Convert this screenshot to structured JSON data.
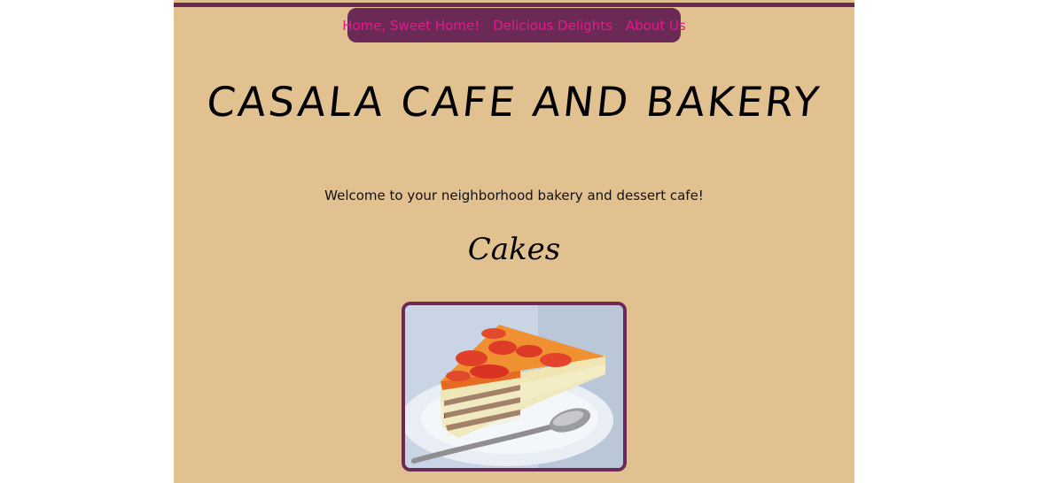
{
  "nav": {
    "items": [
      {
        "label": "Home, Sweet Home!"
      },
      {
        "label": "Delicious Delights"
      },
      {
        "label": "About Us"
      }
    ]
  },
  "header": {
    "title": "CASALA CAFE AND BAKERY"
  },
  "main": {
    "welcome": "Welcome to your neighborhood bakery and dessert cafe!",
    "section_title": "Cakes",
    "cake_image": {
      "icon": "cake-slice-photo"
    }
  },
  "colors": {
    "background": "#e2c191",
    "nav_background": "#6b2a55",
    "nav_link": "#e8178b",
    "frame_border": "#6b2a55"
  }
}
